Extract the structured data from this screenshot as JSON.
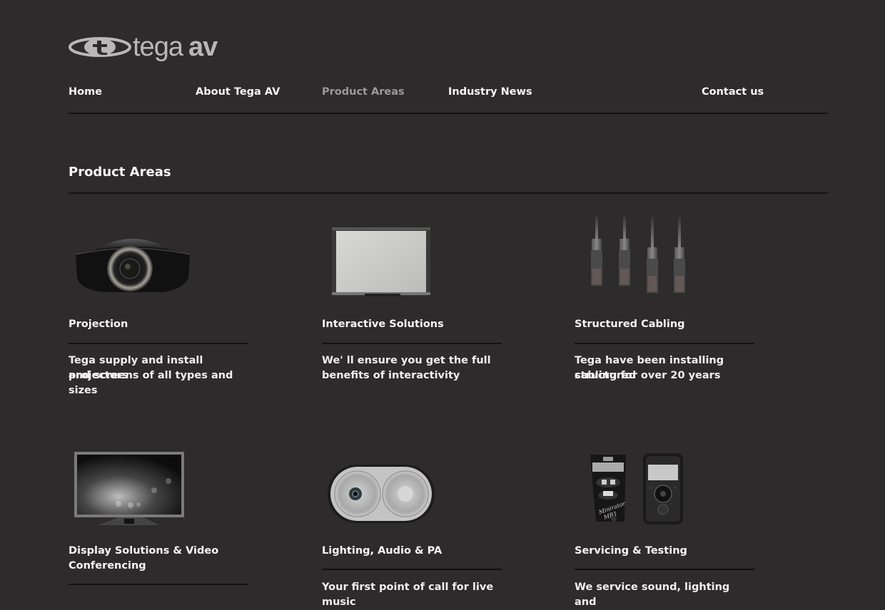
{
  "brand": {
    "logo_mark_letter": "t",
    "logo_word": "tega",
    "logo_word_bold": "av",
    "colors": {
      "background": "#2d2b2c",
      "text": "#f6f6f6",
      "nav_active": "#9a9a9a",
      "rule": "#121212",
      "logo": "#b8b8b8"
    }
  },
  "nav": {
    "items": [
      {
        "label": "Home",
        "active": false
      },
      {
        "label": "About Tega AV",
        "active": false
      },
      {
        "label": "Product Areas",
        "active": true
      },
      {
        "label": "Industry News",
        "active": false
      },
      {
        "label": "Contact us",
        "active": false
      }
    ]
  },
  "page": {
    "title": "Product Areas"
  },
  "products": [
    {
      "name": "Projection",
      "name_line2": "",
      "description_line1": "Tega supply and install projectors",
      "description_line2": "and screens of all types and sizes",
      "image": "projector-image"
    },
    {
      "name": "Interactive Solutions",
      "name_line2": "",
      "description_line1": "We' ll ensure you get the full",
      "description_line2": "benefits of interactivity",
      "image": "interactive-whiteboard-image"
    },
    {
      "name": "Structured Cabling",
      "name_line2": "",
      "description_line1": "Tega have been installing structured",
      "description_line2": "cabling for over 20 years",
      "image": "network-cables-image"
    },
    {
      "name": "Display Solutions & Video",
      "name_line2": "Conferencing",
      "description_line1": "",
      "description_line2": "",
      "image": "display-monitor-image"
    },
    {
      "name": "Lighting, Audio & PA",
      "name_line2": "",
      "description_line1": "Your first point of call for live music",
      "description_line2": "",
      "image": "speaker-image"
    },
    {
      "name": "Servicing & Testing",
      "name_line2": "",
      "description_line1": "We service sound, lighting and",
      "description_line2": "",
      "image": "test-meters-image"
    }
  ]
}
